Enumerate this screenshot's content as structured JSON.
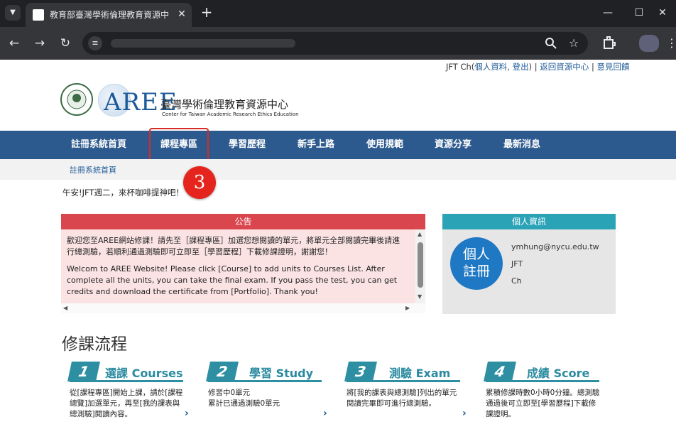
{
  "browser": {
    "tab_title": "教育部臺灣學術倫理教育資源中",
    "tab_menu_icon": "chevron-down-icon",
    "new_tab_icon": "plus-icon",
    "window_controls": [
      "minimize-icon",
      "maximize-icon",
      "close-icon"
    ],
    "nav_icons": [
      "back-icon",
      "forward-icon",
      "reload-icon"
    ],
    "omnibox_icons": [
      "zoom-icon",
      "star-icon"
    ],
    "extensions_icon": "puzzle-icon",
    "menu_icon": "more-vert-icon"
  },
  "userlinks": {
    "prefix": "JFT Ch(",
    "profile": "個人資料",
    "sep1": ", ",
    "logout": "登出",
    "suffix": ") | ",
    "back_resource": "返回資源中心",
    "sep2": " | ",
    "feedback": "意見回饋"
  },
  "logo": {
    "seal_text": "MINISTRY OF EDUCATION",
    "seal_zh": "教育部",
    "wordmark": "AREE",
    "title": "臺灣學術倫理教育資源中心",
    "subtitle": "Center for Taiwan Academic Research Ethics Education"
  },
  "nav": {
    "items": [
      {
        "label": "註冊系統首頁"
      },
      {
        "label": "課程專區"
      },
      {
        "label": "學習歷程"
      },
      {
        "label": "新手上路"
      },
      {
        "label": "使用規範"
      },
      {
        "label": "資源分享"
      },
      {
        "label": "最新消息"
      }
    ],
    "highlight_color": "#d62b26",
    "bar_color": "#2d5a8e"
  },
  "breadcrumb": "註冊系統首頁",
  "greeting": "午安!JFT週二，來杯咖啡提神吧！",
  "annotation_badge": "3",
  "announcement": {
    "header": "公告",
    "text_zh": "歡迎您至AREE網站修課！請先至［課程專區］加選您想閱讀的單元，將單元全部閱讀完畢後請進行總測驗，若順利通過測驗即可立即至［學習歷程］下載修課證明，謝謝您！",
    "text_en": "Welcom to AREE Website! Please click [Course] to add units to Courses List. After complete all the units, you can take the final exam.  If you pass the test, you can get credits and download the certificate from [Portfolio]. Thank you!",
    "header_color": "#d9464e",
    "body_color": "#fbe3e3"
  },
  "profile_box": {
    "header": "個人資訊",
    "avatar_line1": "個人",
    "avatar_line2": "註冊",
    "email": "ymhung@nycu.edu.tw",
    "name1": "JFT",
    "name2": "Ch",
    "header_color": "#2ba3b7"
  },
  "process": {
    "title": "修課流程",
    "steps": [
      {
        "num": "1",
        "label": "選課 Courses",
        "desc": "從[課程專區]開始上課，請於[課程總覽]加選單元，再至[我的課表與總測驗]閱讀內容。"
      },
      {
        "num": "2",
        "label": "學習 Study",
        "desc": "修習中0單元\n累計已通過測驗0單元"
      },
      {
        "num": "3",
        "label": "測驗 Exam",
        "desc": "將[我的課表與總測驗]列出的單元閱讀完畢即可進行總測驗。"
      },
      {
        "num": "4",
        "label": "成績 Score",
        "desc": "累積修課時數0小時0分鐘。總測驗通過後可立即至[學習歷程]下載修課證明。"
      }
    ],
    "accent_color": "#2e8ea2"
  }
}
